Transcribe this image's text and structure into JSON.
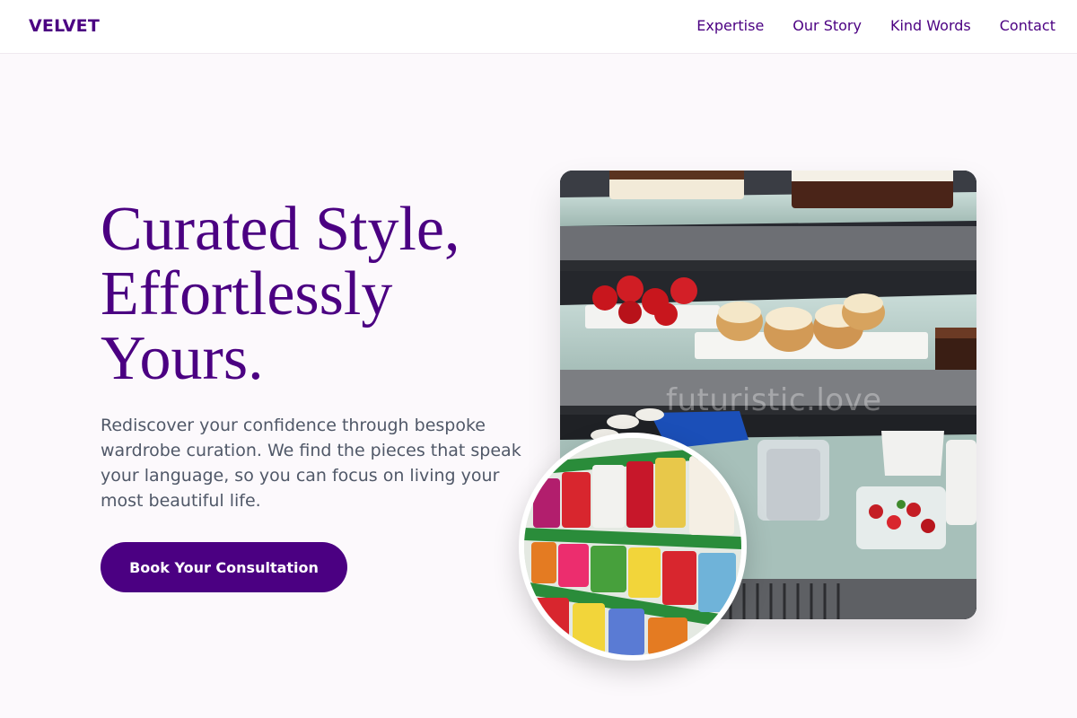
{
  "brand": {
    "name": "VELVET",
    "primary_color": "#4b0082"
  },
  "nav": {
    "items": [
      {
        "label": "Expertise"
      },
      {
        "label": "Our Story"
      },
      {
        "label": "Kind Words"
      },
      {
        "label": "Contact"
      }
    ]
  },
  "hero": {
    "headline_line1": "Curated Style,",
    "headline_line2": "Effortlessly",
    "headline_line3": "Yours.",
    "subtext": "Rediscover your confidence through bespoke wardrobe curation. We find the pieces that speak your language, so you can focus on living your most beautiful life.",
    "cta_label": "Book Your Consultation"
  },
  "images": {
    "main_photo": {
      "subject": "bakery display case with cakes and pastries",
      "watermark": "futuristic.love"
    },
    "circle_photo": {
      "subject": "supermarket shelf with packaged candy"
    }
  }
}
